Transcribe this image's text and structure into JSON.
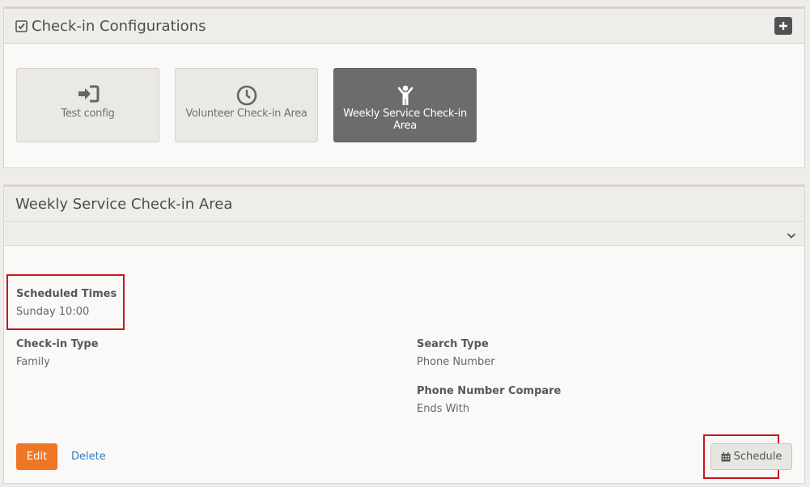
{
  "config_panel": {
    "title": "Check-in Configurations",
    "title_icon": "checkbox-icon",
    "add_icon": "plus-icon",
    "tiles": [
      {
        "label": "Test config",
        "icon": "sign-in-icon",
        "active": false
      },
      {
        "label": "Volunteer Check-in Area",
        "icon": "clock-icon",
        "active": false
      },
      {
        "label": "Weekly Service Check-in Area",
        "icon": "child-icon",
        "active": true
      }
    ]
  },
  "area_panel": {
    "title": "Weekly Service Check-in Area",
    "collapse_icon": "chevron-down-icon",
    "fields": {
      "scheduled_times": {
        "label": "Scheduled Times",
        "value": "Sunday 10:00"
      },
      "checkin_type": {
        "label": "Check-in Type",
        "value": "Family"
      },
      "search_type": {
        "label": "Search Type",
        "value": "Phone Number"
      },
      "phone_compare": {
        "label": "Phone Number Compare",
        "value": "Ends With"
      }
    },
    "actions": {
      "edit": "Edit",
      "delete": "Delete",
      "schedule": "Schedule",
      "schedule_icon": "calendar-icon"
    }
  },
  "colors": {
    "accent_orange": "#ee7624",
    "link_blue": "#2e7bc4",
    "active_tile": "#6c6c6c",
    "highlight_red": "#c8161e"
  }
}
